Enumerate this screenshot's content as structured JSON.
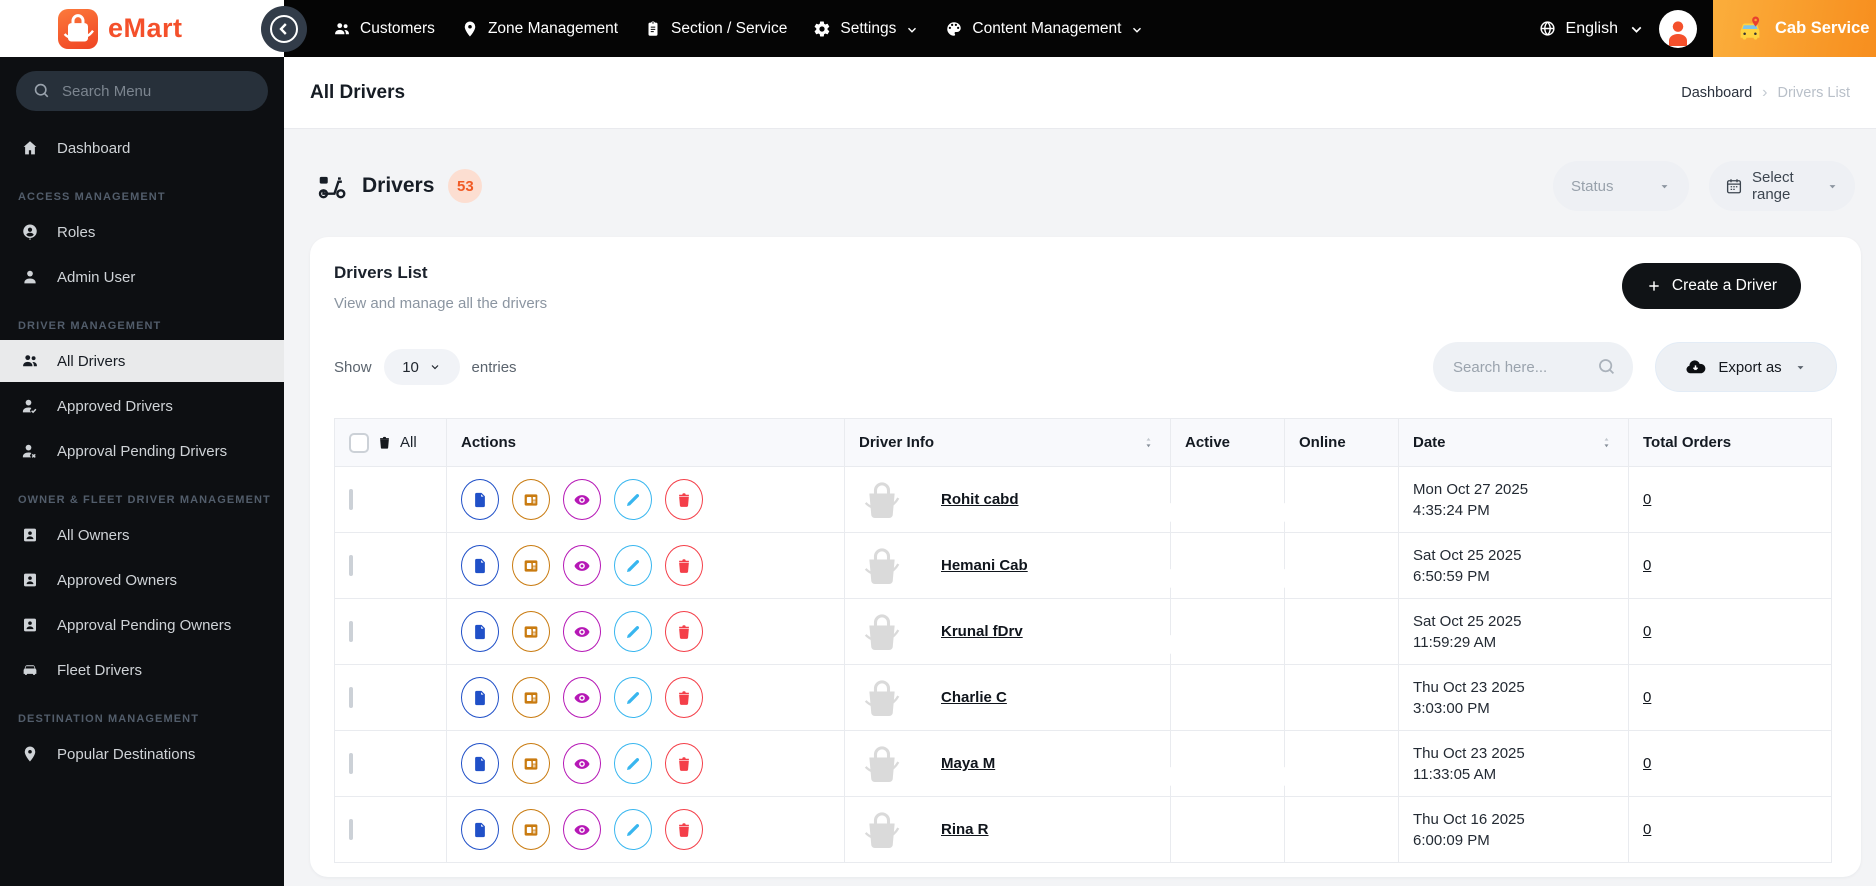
{
  "brand": {
    "name": "eMart",
    "service": "Cab Service"
  },
  "navbar": {
    "items": [
      {
        "label": "Customers",
        "icon": "people",
        "dropdown": false
      },
      {
        "label": "Zone Management",
        "icon": "location-pin",
        "dropdown": false
      },
      {
        "label": "Section / Service",
        "icon": "clipboard",
        "dropdown": false
      },
      {
        "label": "Settings",
        "icon": "gear",
        "dropdown": true
      },
      {
        "label": "Content Management",
        "icon": "palette",
        "dropdown": true
      }
    ],
    "language": "English"
  },
  "sidebar": {
    "search_placeholder": "Search Menu",
    "sections": [
      {
        "label": "",
        "items": [
          {
            "label": "Dashboard",
            "icon": "home"
          }
        ]
      },
      {
        "label": "ACCESS MANAGEMENT",
        "items": [
          {
            "label": "Roles",
            "icon": "person-pin"
          },
          {
            "label": "Admin User",
            "icon": "person"
          }
        ]
      },
      {
        "label": "DRIVER MANAGEMENT",
        "items": [
          {
            "label": "All Drivers",
            "icon": "people",
            "active": true
          },
          {
            "label": "Approved Drivers",
            "icon": "person-check"
          },
          {
            "label": "Approval Pending Drivers",
            "icon": "person-x"
          }
        ]
      },
      {
        "label": "OWNER & FLEET DRIVER MANAGEMENT",
        "items": [
          {
            "label": "All Owners",
            "icon": "badge"
          },
          {
            "label": "Approved Owners",
            "icon": "badge"
          },
          {
            "label": "Approval Pending Owners",
            "icon": "badge"
          },
          {
            "label": "Fleet Drivers",
            "icon": "car"
          }
        ]
      },
      {
        "label": "DESTINATION MANAGEMENT",
        "items": [
          {
            "label": "Popular Destinations",
            "icon": "location-pin"
          }
        ]
      }
    ]
  },
  "page": {
    "title": "All Drivers",
    "breadcrumb": [
      "Dashboard",
      "Drivers List"
    ]
  },
  "toolbar": {
    "title": "Drivers",
    "count": "53",
    "status_placeholder": "Status",
    "range_label": "Select range"
  },
  "card": {
    "title": "Drivers List",
    "subtitle": "View and manage all the drivers",
    "create_label": "Create a Driver",
    "show_label": "Show",
    "entries_value": "10",
    "entries_label": "entries",
    "search_placeholder": "Search here...",
    "export_label": "Export as"
  },
  "table": {
    "select_all_label": "All",
    "headers": [
      "Actions",
      "Driver Info",
      "Active",
      "Online",
      "Date",
      "Total Orders"
    ],
    "action_icons": [
      "file-icon",
      "id-card-icon",
      "eye-icon",
      "pencil-icon",
      "trash-icon"
    ],
    "rows": [
      {
        "name": "Rohit cabd",
        "active": true,
        "online": true,
        "date": "Mon Oct 27 2025",
        "time": "4:35:24 PM",
        "orders": "0"
      },
      {
        "name": "Hemani Cab",
        "active": true,
        "online": true,
        "date": "Sat Oct 25 2025",
        "time": "6:50:59 PM",
        "orders": "0"
      },
      {
        "name": "Krunal fDrv",
        "active": true,
        "online": false,
        "date": "Sat Oct 25 2025",
        "time": "11:59:29 AM",
        "orders": "0"
      },
      {
        "name": "Charlie C",
        "active": false,
        "online": false,
        "date": "Thu Oct 23 2025",
        "time": "3:03:00 PM",
        "orders": "0"
      },
      {
        "name": "Maya M",
        "active": true,
        "online": true,
        "date": "Thu Oct 23 2025",
        "time": "11:33:05 AM",
        "orders": "0"
      },
      {
        "name": "Rina R",
        "active": false,
        "online": false,
        "date": "Thu Oct 16 2025",
        "time": "6:00:09 PM",
        "orders": "0"
      }
    ]
  },
  "colors": {
    "brand_orange": "#f4502b",
    "toggle_on": "#00b23c",
    "toggle_off": "#f50000",
    "action_file": "#2050c8",
    "action_card": "#c97b10",
    "action_eye": "#b618b6",
    "action_edit": "#38b6ef",
    "action_delete": "#f43f49",
    "count_badge_bg": "#fcded1"
  }
}
